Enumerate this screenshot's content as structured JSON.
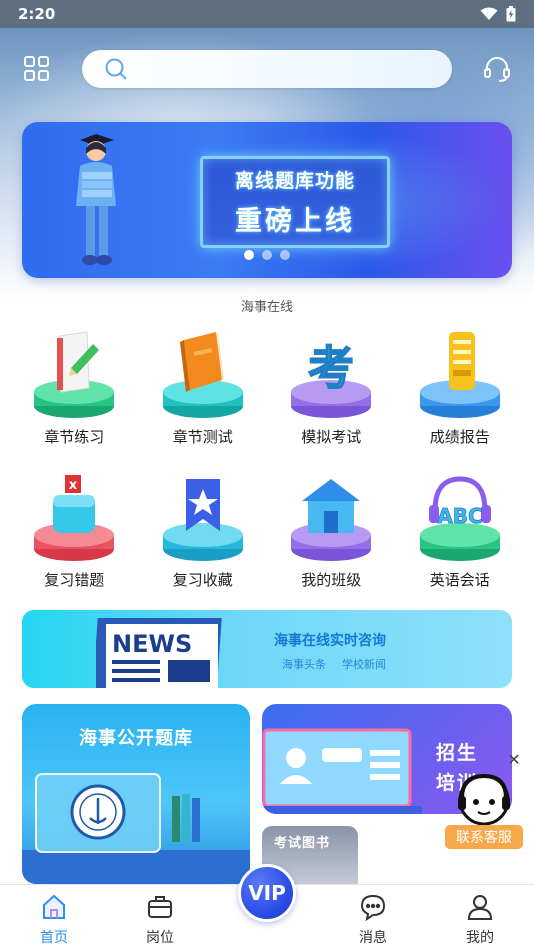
{
  "status_bar": {
    "time": "2:20"
  },
  "search": {
    "placeholder": ""
  },
  "banner": {
    "line1": "离线题库功能",
    "line2": "重磅上线",
    "dots": 3,
    "active_dot": 0
  },
  "app_subtitle": "海事在线",
  "menu": [
    {
      "label": "章节练习",
      "icon": "notebook-pencil-icon"
    },
    {
      "label": "章节测试",
      "icon": "book-icon"
    },
    {
      "label": "模拟考试",
      "icon": "exam-character-icon"
    },
    {
      "label": "成绩报告",
      "icon": "report-icon"
    },
    {
      "label": "复习错题",
      "icon": "wrong-answer-icon"
    },
    {
      "label": "复习收藏",
      "icon": "star-bookmark-icon"
    },
    {
      "label": "我的班级",
      "icon": "classroom-icon"
    },
    {
      "label": "英语会话",
      "icon": "abc-headset-icon"
    }
  ],
  "news_banner": {
    "badge": "NEWS",
    "title": "海事在线实时咨询",
    "tags": [
      "海事头条",
      "学校新闻"
    ]
  },
  "cards": {
    "question_bank": "海事公开题库",
    "training": "招生培训",
    "books": "考试图书"
  },
  "float_service": {
    "label": "联系客服"
  },
  "tab_bar": {
    "home": "首页",
    "jobs": "岗位",
    "vip": "VIP",
    "messages": "消息",
    "mine": "我的"
  },
  "colors": {
    "accent": "#2e8ff0",
    "banner_blue": "#2f6cf0",
    "service_orange": "#f7a84b",
    "news_cyan": "#22d6f2"
  }
}
